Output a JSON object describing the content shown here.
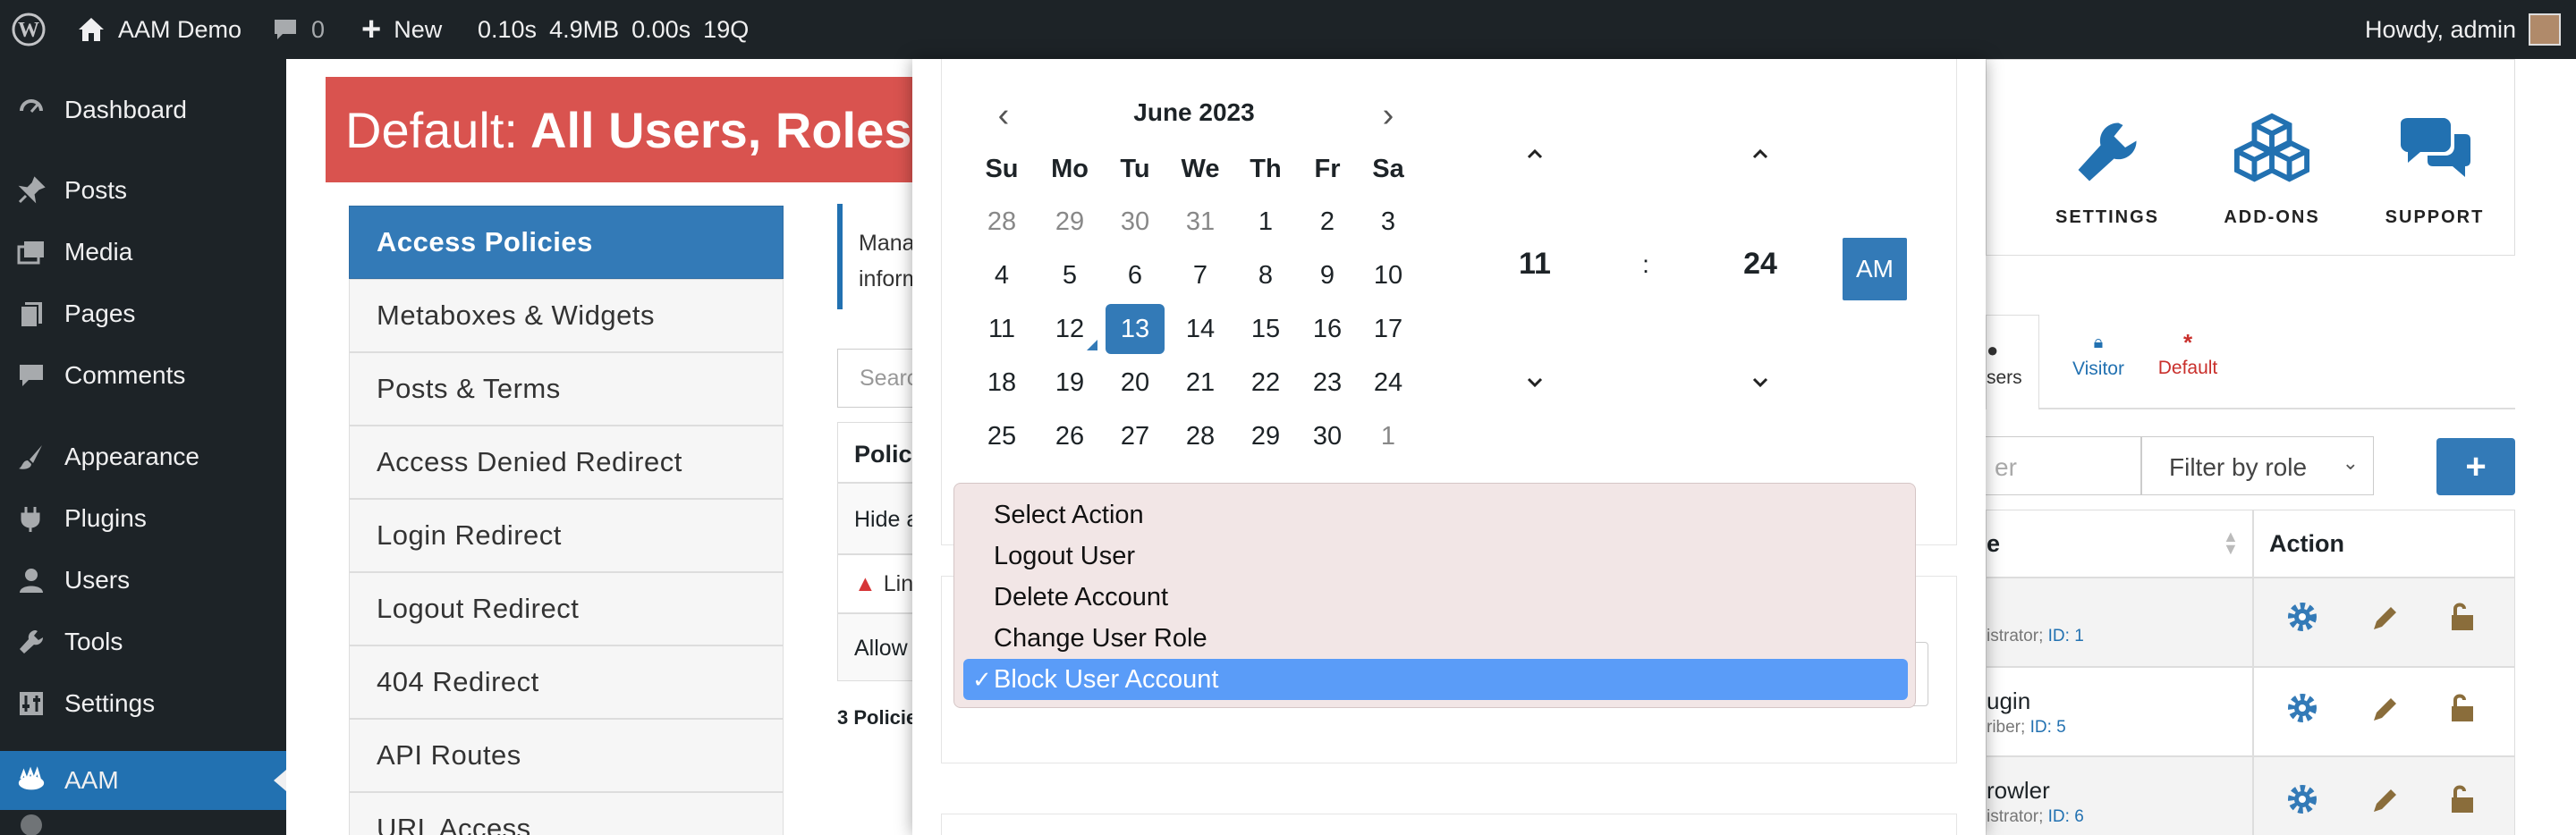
{
  "adminbar": {
    "site_name": "AAM Demo",
    "comments_count": "0",
    "new_label": "New",
    "perf": [
      "0.10s",
      "4.9MB",
      "0.00s",
      "19Q"
    ],
    "greeting": "Howdy, admin"
  },
  "menu": [
    {
      "label": "Dashboard",
      "icon": "dashboard-icon"
    },
    {
      "label": "Posts",
      "icon": "pin-icon"
    },
    {
      "label": "Media",
      "icon": "media-icon"
    },
    {
      "label": "Pages",
      "icon": "pages-icon"
    },
    {
      "label": "Comments",
      "icon": "comments-icon"
    },
    {
      "label": "Appearance",
      "icon": "brush-icon"
    },
    {
      "label": "Plugins",
      "icon": "plugin-icon"
    },
    {
      "label": "Users",
      "icon": "user-icon"
    },
    {
      "label": "Tools",
      "icon": "wrench-icon"
    },
    {
      "label": "Settings",
      "icon": "sliders-icon"
    },
    {
      "label": "AAM",
      "icon": "aam-icon"
    }
  ],
  "banner": {
    "prefix": "Default:",
    "title": "All Users, Roles"
  },
  "sidebar": [
    "Access Policies",
    "Metaboxes & Widgets",
    "Posts & Terms",
    "Access Denied Redirect",
    "Login Redirect",
    "Logout Redirect",
    "404 Redirect",
    "API Routes",
    "URL Access"
  ],
  "center": {
    "info_line1": "Mana",
    "info_line2": "inform",
    "search_placeholder": "Searc",
    "col_header": "Polic",
    "rows": [
      "Hide a",
      "Lin",
      "Allow"
    ],
    "footer": "3 Policie"
  },
  "tiles": [
    {
      "label": "SETTINGS",
      "icon": "wrench-icon"
    },
    {
      "label": "ADD-ONS",
      "icon": "cubes-icon"
    },
    {
      "label": "SUPPORT",
      "icon": "chat-icon"
    }
  ],
  "subject_tabs": [
    {
      "label": "sers",
      "icon": "user-icon"
    },
    {
      "label": "Visitor",
      "icon": "lock-icon"
    },
    {
      "label": "Default",
      "icon": "asterisk-icon"
    }
  ],
  "users_panel": {
    "filter_placeholder": "er",
    "role_filter": "Filter by role",
    "add_symbol": "+",
    "col_name": "e",
    "col_action": "Action",
    "users": [
      {
        "name": "",
        "role": "istrator;",
        "id_label": "ID: 1"
      },
      {
        "name": "ugin",
        "role": "riber;",
        "id_label": "ID: 5"
      },
      {
        "name": "rowler",
        "role": "istrator;",
        "id_label": "ID: 6"
      }
    ]
  },
  "datepicker": {
    "month": "June 2023",
    "prev": "‹",
    "next": "›",
    "dow": [
      "Su",
      "Mo",
      "Tu",
      "We",
      "Th",
      "Fr",
      "Sa"
    ],
    "weeks": [
      [
        "28",
        "29",
        "30",
        "31",
        "1",
        "2",
        "3"
      ],
      [
        "4",
        "5",
        "6",
        "7",
        "8",
        "9",
        "10"
      ],
      [
        "11",
        "12",
        "13",
        "14",
        "15",
        "16",
        "17"
      ],
      [
        "18",
        "19",
        "20",
        "21",
        "22",
        "23",
        "24"
      ],
      [
        "25",
        "26",
        "27",
        "28",
        "29",
        "30",
        "1"
      ]
    ],
    "selected_day": "13",
    "today_day": "12",
    "hour": "11",
    "sep": ":",
    "minute": "24",
    "ampm": "AM"
  },
  "action_dropdown": {
    "options": [
      "Select Action",
      "Logout User",
      "Delete Account",
      "Change User Role",
      "Block User Account"
    ],
    "selected": "Block User Account",
    "check": "✓"
  }
}
